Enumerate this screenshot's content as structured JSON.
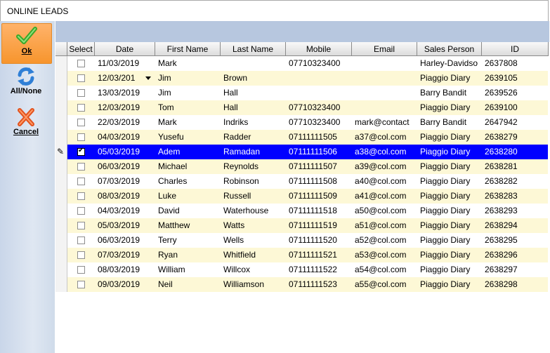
{
  "window": {
    "title": "ONLINE LEADS"
  },
  "sidebar": {
    "ok_label": "Ok",
    "allnone_label": "All/None",
    "cancel_label": "Cancel"
  },
  "colors": {
    "selected_row": "#0000ff",
    "stripe": "#fdf8d6",
    "ok_button": "#f7952d"
  },
  "grid": {
    "columns": [
      "Select",
      "Date",
      "First Name",
      "Last Name",
      "Mobile",
      "Email",
      "Sales Person",
      "ID"
    ],
    "rows": [
      {
        "checked": false,
        "date": "11/03/2019",
        "first": "Mark",
        "last": "",
        "mobile": "07710323400",
        "email": "",
        "sales": "Harley-Davidso",
        "id": "2637808"
      },
      {
        "checked": false,
        "date": "12/03/201",
        "first": "Jim",
        "last": "Brown",
        "mobile": "",
        "email": "",
        "sales": "Piaggio Diary",
        "id": "2639105"
      },
      {
        "checked": false,
        "date": "13/03/2019",
        "first": "Jim",
        "last": "Hall",
        "mobile": "",
        "email": "",
        "sales": "Barry Bandit",
        "id": "2639526"
      },
      {
        "checked": false,
        "date": "12/03/2019",
        "first": "Tom",
        "last": "Hall",
        "mobile": "07710323400",
        "email": "",
        "sales": "Piaggio Diary",
        "id": "2639100"
      },
      {
        "checked": false,
        "date": "22/03/2019",
        "first": "Mark",
        "last": "Indriks",
        "mobile": "07710323400",
        "email": "mark@contact",
        "sales": "Barry Bandit",
        "id": "2647942"
      },
      {
        "checked": false,
        "date": "04/03/2019",
        "first": "Yusefu",
        "last": "Radder",
        "mobile": "07111111505",
        "email": "a37@col.com",
        "sales": "Piaggio Diary",
        "id": "2638279"
      },
      {
        "checked": true,
        "date": "05/03/2019",
        "first": "Adem",
        "last": "Ramadan",
        "mobile": "07111111506",
        "email": "a38@col.com",
        "sales": "Piaggio Diary",
        "id": "2638280"
      },
      {
        "checked": false,
        "date": "06/03/2019",
        "first": "Michael",
        "last": "Reynolds",
        "mobile": "07111111507",
        "email": "a39@col.com",
        "sales": "Piaggio Diary",
        "id": "2638281"
      },
      {
        "checked": false,
        "date": "07/03/2019",
        "first": "Charles",
        "last": "Robinson",
        "mobile": "07111111508",
        "email": "a40@col.com",
        "sales": "Piaggio Diary",
        "id": "2638282"
      },
      {
        "checked": false,
        "date": "08/03/2019",
        "first": "Luke",
        "last": "Russell",
        "mobile": "07111111509",
        "email": "a41@col.com",
        "sales": "Piaggio Diary",
        "id": "2638283"
      },
      {
        "checked": false,
        "date": "04/03/2019",
        "first": "David",
        "last": "Waterhouse",
        "mobile": "07111111518",
        "email": "a50@col.com",
        "sales": "Piaggio Diary",
        "id": "2638293"
      },
      {
        "checked": false,
        "date": "05/03/2019",
        "first": "Matthew",
        "last": "Watts",
        "mobile": "07111111519",
        "email": "a51@col.com",
        "sales": "Piaggio Diary",
        "id": "2638294"
      },
      {
        "checked": false,
        "date": "06/03/2019",
        "first": "Terry",
        "last": "Wells",
        "mobile": "07111111520",
        "email": "a52@col.com",
        "sales": "Piaggio Diary",
        "id": "2638295"
      },
      {
        "checked": false,
        "date": "07/03/2019",
        "first": "Ryan",
        "last": "Whitfield",
        "mobile": "07111111521",
        "email": "a53@col.com",
        "sales": "Piaggio Diary",
        "id": "2638296"
      },
      {
        "checked": false,
        "date": "08/03/2019",
        "first": "William",
        "last": "Willcox",
        "mobile": "07111111522",
        "email": "a54@col.com",
        "sales": "Piaggio Diary",
        "id": "2638297"
      },
      {
        "checked": false,
        "date": "09/03/2019",
        "first": "Neil",
        "last": "Williamson",
        "mobile": "07111111523",
        "email": "a55@col.com",
        "sales": "Piaggio Diary",
        "id": "2638298"
      }
    ],
    "selected_row_index": 6,
    "editing_row_index": 6,
    "dropdown_row_index": 1
  }
}
